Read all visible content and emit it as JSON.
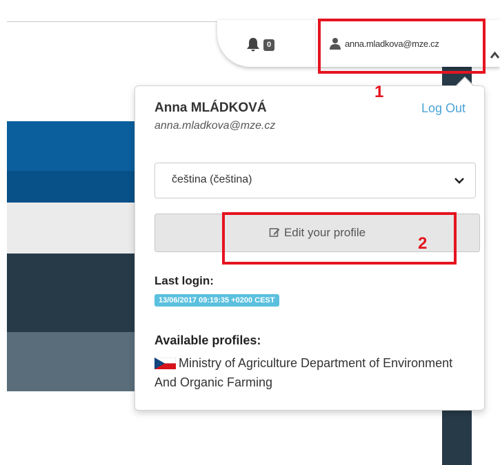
{
  "topbar": {
    "notification_count": "0",
    "user_email": "anna.mladkova@mze.cz"
  },
  "dropdown": {
    "full_name": "Anna MLÁDKOVÁ",
    "email": "anna.mladkova@mze.cz",
    "logout_label": "Log Out",
    "language_selected": "čeština (čeština)",
    "edit_profile_label": "Edit your profile",
    "last_login_label": "Last login:",
    "last_login_value": "13/06/2017 09:19:35 +0200 CEST",
    "available_profiles_label": "Available profiles:",
    "profiles": [
      {
        "name": "Ministry of Agriculture Department of Environment And Organic Farming",
        "flag": "czech-flag-icon"
      }
    ]
  },
  "annotations": {
    "label_1": "1",
    "label_2": "2"
  },
  "colors": {
    "annotation_red": "#e5141f",
    "link_blue": "#4aa3d8",
    "badge_cyan": "#5bc0de"
  }
}
